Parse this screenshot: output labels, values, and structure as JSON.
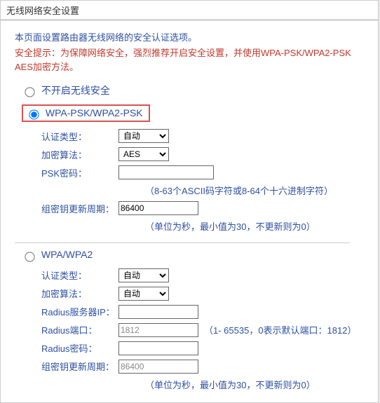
{
  "title": "无线网络安全设置",
  "intro": "本页面设置路由器无线网络的安全认证选项。",
  "warn": "安全提示：为保障网络安全，强烈推荐开启安全设置，并使用WPA-PSK/WPA2-PSK AES加密方法。",
  "radio_disable": "不开启无线安全",
  "radio_psk": "WPA-PSK/WPA2-PSK",
  "radio_wpa": "WPA/WPA2",
  "labels": {
    "auth": "认证类型：",
    "enc": "加密算法：",
    "psk": "PSK密码：",
    "rekey": "组密钥更新周期：",
    "radius_ip": "Radius服务器IP：",
    "radius_port": "Radius端口：",
    "radius_pwd": "Radius密码："
  },
  "opts": {
    "auto": "自动",
    "aes": "AES"
  },
  "vals": {
    "psk_pwd": "",
    "rekey": "86400",
    "radius_ip": "",
    "radius_port": "1812",
    "radius_pwd": "",
    "rekey2": "86400"
  },
  "hints": {
    "psk": "（8-63个ASCII码字符或8-64个十六进制字符）",
    "rekey": "（单位为秒，最小值为30，不更新则为0）",
    "port": "（1- 65535，0表示默认端口：1812）"
  }
}
